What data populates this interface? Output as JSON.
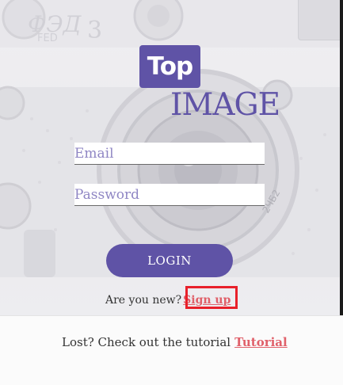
{
  "logo": {
    "top": "Top",
    "image": "IMAGE"
  },
  "form": {
    "email_placeholder": "Email",
    "password_placeholder": "Password",
    "login_label": "LOGIN"
  },
  "signup": {
    "prompt": "Are you new?",
    "link": "Sign up"
  },
  "tutorial": {
    "prompt": "Lost? Check out the tutorial",
    "link": "Tutorial"
  },
  "colors": {
    "brand": "#5f53a6",
    "link": "#e0606a",
    "highlight": "#e8202a"
  }
}
